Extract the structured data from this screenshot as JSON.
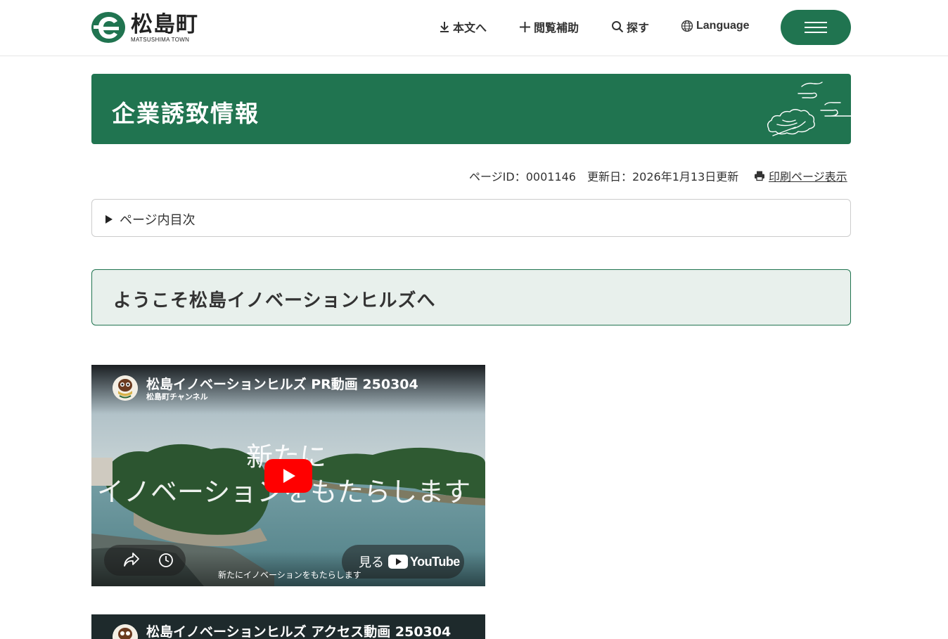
{
  "header": {
    "logo_title": "松島町",
    "logo_sub": "MATSUSHIMA TOWN",
    "nav": {
      "honbun": "本文へ",
      "assist": "閲覧補助",
      "search": "探す",
      "language": "Language"
    }
  },
  "page": {
    "title": "企業誘致情報",
    "page_id": "ページID：0001146",
    "updated": "更新日：2026年1月13日更新",
    "print_link": "印刷ページ表示",
    "toc_label": "ページ内目次",
    "section_heading": "ようこそ松島イノベーションヒルズへ"
  },
  "videos": [
    {
      "title": "松島イノベーションヒルズ PR動画 250304",
      "channel": "松島町チャンネル",
      "overlay_line1": "新たに",
      "overlay_line2": "イノベーションをもたらします",
      "watch_label": "見る",
      "youtube_word": "YouTube",
      "caption": "新たにイノベーションをもたらします"
    },
    {
      "title": "松島イノベーションヒルズ アクセス動画 250304"
    }
  ],
  "colors": {
    "brand_green": "#207450",
    "section_bg": "#e8f0ec",
    "youtube_red": "#ff0000"
  }
}
